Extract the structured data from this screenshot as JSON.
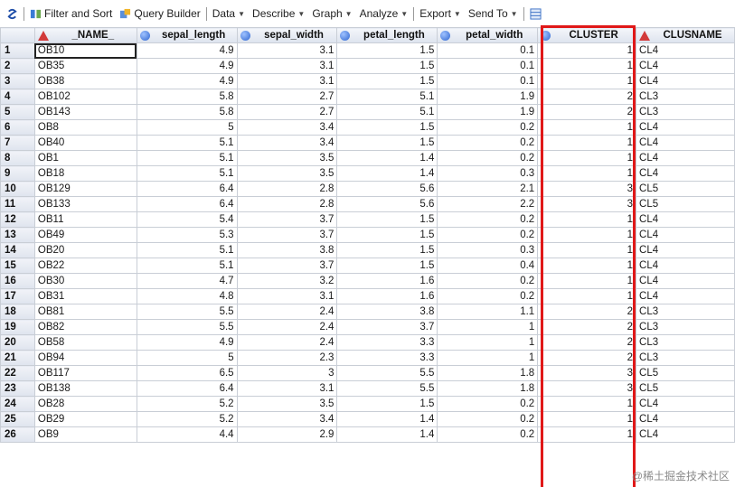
{
  "toolbar": {
    "items": [
      {
        "label": "Filter and Sort",
        "caret": false
      },
      {
        "label": "Query Builder",
        "caret": false
      },
      {
        "label": "Data",
        "caret": true
      },
      {
        "label": "Describe",
        "caret": true
      },
      {
        "label": "Graph",
        "caret": true
      },
      {
        "label": "Analyze",
        "caret": true
      },
      {
        "label": "Export",
        "caret": true
      },
      {
        "label": "Send To",
        "caret": true
      }
    ]
  },
  "columns": [
    {
      "name": "_NAME_",
      "type": "char"
    },
    {
      "name": "sepal_length",
      "type": "num"
    },
    {
      "name": "sepal_width",
      "type": "num"
    },
    {
      "name": "petal_length",
      "type": "num"
    },
    {
      "name": "petal_width",
      "type": "num"
    },
    {
      "name": "CLUSTER",
      "type": "num"
    },
    {
      "name": "CLUSNAME",
      "type": "char"
    }
  ],
  "rows": [
    [
      "1",
      "OB10",
      "4.9",
      "3.1",
      "1.5",
      "0.1",
      "1",
      "CL4"
    ],
    [
      "2",
      "OB35",
      "4.9",
      "3.1",
      "1.5",
      "0.1",
      "1",
      "CL4"
    ],
    [
      "3",
      "OB38",
      "4.9",
      "3.1",
      "1.5",
      "0.1",
      "1",
      "CL4"
    ],
    [
      "4",
      "OB102",
      "5.8",
      "2.7",
      "5.1",
      "1.9",
      "2",
      "CL3"
    ],
    [
      "5",
      "OB143",
      "5.8",
      "2.7",
      "5.1",
      "1.9",
      "2",
      "CL3"
    ],
    [
      "6",
      "OB8",
      "5",
      "3.4",
      "1.5",
      "0.2",
      "1",
      "CL4"
    ],
    [
      "7",
      "OB40",
      "5.1",
      "3.4",
      "1.5",
      "0.2",
      "1",
      "CL4"
    ],
    [
      "8",
      "OB1",
      "5.1",
      "3.5",
      "1.4",
      "0.2",
      "1",
      "CL4"
    ],
    [
      "9",
      "OB18",
      "5.1",
      "3.5",
      "1.4",
      "0.3",
      "1",
      "CL4"
    ],
    [
      "10",
      "OB129",
      "6.4",
      "2.8",
      "5.6",
      "2.1",
      "3",
      "CL5"
    ],
    [
      "11",
      "OB133",
      "6.4",
      "2.8",
      "5.6",
      "2.2",
      "3",
      "CL5"
    ],
    [
      "12",
      "OB11",
      "5.4",
      "3.7",
      "1.5",
      "0.2",
      "1",
      "CL4"
    ],
    [
      "13",
      "OB49",
      "5.3",
      "3.7",
      "1.5",
      "0.2",
      "1",
      "CL4"
    ],
    [
      "14",
      "OB20",
      "5.1",
      "3.8",
      "1.5",
      "0.3",
      "1",
      "CL4"
    ],
    [
      "15",
      "OB22",
      "5.1",
      "3.7",
      "1.5",
      "0.4",
      "1",
      "CL4"
    ],
    [
      "16",
      "OB30",
      "4.7",
      "3.2",
      "1.6",
      "0.2",
      "1",
      "CL4"
    ],
    [
      "17",
      "OB31",
      "4.8",
      "3.1",
      "1.6",
      "0.2",
      "1",
      "CL4"
    ],
    [
      "18",
      "OB81",
      "5.5",
      "2.4",
      "3.8",
      "1.1",
      "2",
      "CL3"
    ],
    [
      "19",
      "OB82",
      "5.5",
      "2.4",
      "3.7",
      "1",
      "2",
      "CL3"
    ],
    [
      "20",
      "OB58",
      "4.9",
      "2.4",
      "3.3",
      "1",
      "2",
      "CL3"
    ],
    [
      "21",
      "OB94",
      "5",
      "2.3",
      "3.3",
      "1",
      "2",
      "CL3"
    ],
    [
      "22",
      "OB117",
      "6.5",
      "3",
      "5.5",
      "1.8",
      "3",
      "CL5"
    ],
    [
      "23",
      "OB138",
      "6.4",
      "3.1",
      "5.5",
      "1.8",
      "3",
      "CL5"
    ],
    [
      "24",
      "OB28",
      "5.2",
      "3.5",
      "1.5",
      "0.2",
      "1",
      "CL4"
    ],
    [
      "25",
      "OB29",
      "5.2",
      "3.4",
      "1.4",
      "0.2",
      "1",
      "CL4"
    ],
    [
      "26",
      "OB9",
      "4.4",
      "2.9",
      "1.4",
      "0.2",
      "1",
      "CL4"
    ]
  ],
  "watermark": "@稀土掘金技术社区",
  "colors": {
    "highlight": "#e01818",
    "numeric_icon": "#2f66d0",
    "char_icon": "#d23a3a"
  }
}
